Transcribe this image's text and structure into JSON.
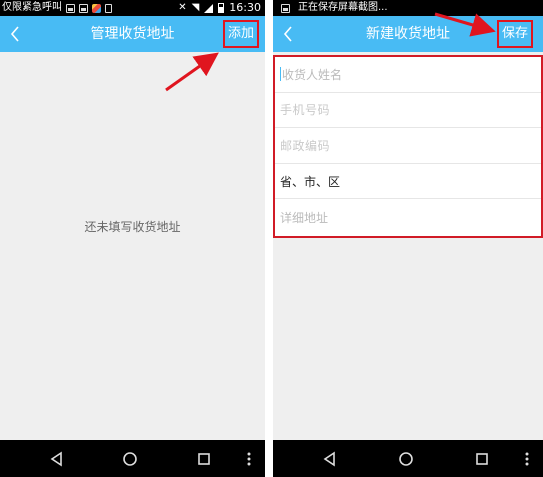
{
  "left_screen": {
    "status_bar": {
      "carrier_text": "仅限紧急呼叫",
      "time": "16:30"
    },
    "title_bar": {
      "title": "管理收货地址",
      "action_label": "添加"
    },
    "empty_message": "还未填写收货地址"
  },
  "right_screen": {
    "status_bar": {
      "notification_text": "正在保存屏幕截图..."
    },
    "title_bar": {
      "title": "新建收货地址",
      "action_label": "保存"
    },
    "form": {
      "name_placeholder": "收货人姓名",
      "phone_placeholder": "手机号码",
      "postcode_placeholder": "邮政编码",
      "region_value": "省、市、区",
      "address_placeholder": "详细地址"
    }
  },
  "colors": {
    "title_bar": "#48bbf4",
    "highlight": "#e0151f",
    "background": "#efefef"
  },
  "icons": [
    "back-arrow-icon",
    "nav-back-icon",
    "nav-home-icon",
    "nav-recents-icon",
    "nav-menu-icon"
  ]
}
